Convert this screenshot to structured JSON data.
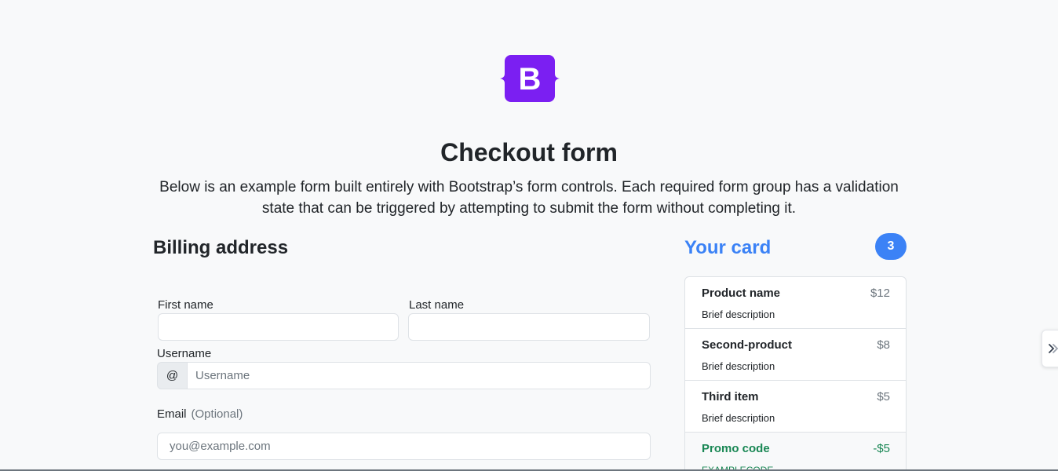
{
  "logo": {
    "letter": "B",
    "color": "#7b1ff2"
  },
  "header": {
    "title": "Checkout form",
    "lead": "Below is an example form built entirely with Bootstrap’s form controls. Each required form group has a validation state that can be triggered by attempting to submit the form without completing it."
  },
  "billing": {
    "title": "Billing address",
    "first_name": {
      "label": "First name",
      "value": ""
    },
    "last_name": {
      "label": "Last name",
      "value": ""
    },
    "username": {
      "label": "Username",
      "addon": "@",
      "placeholder": "Username"
    },
    "email": {
      "label": "Email",
      "optional": "(Optional)",
      "placeholder": "you@example.com"
    }
  },
  "cart": {
    "title": "Your card",
    "count": "3",
    "accent": "#3b82f6",
    "items": [
      {
        "name": "Product name",
        "description": "Brief description",
        "price": "$12"
      },
      {
        "name": "Second-product",
        "description": "Brief description",
        "price": "$8"
      },
      {
        "name": "Third item",
        "description": "Brief description",
        "price": "$5"
      }
    ],
    "promo": {
      "name": "Promo code",
      "code": "EXAMPLECODE",
      "price": "-$5",
      "color": "#198754"
    }
  }
}
